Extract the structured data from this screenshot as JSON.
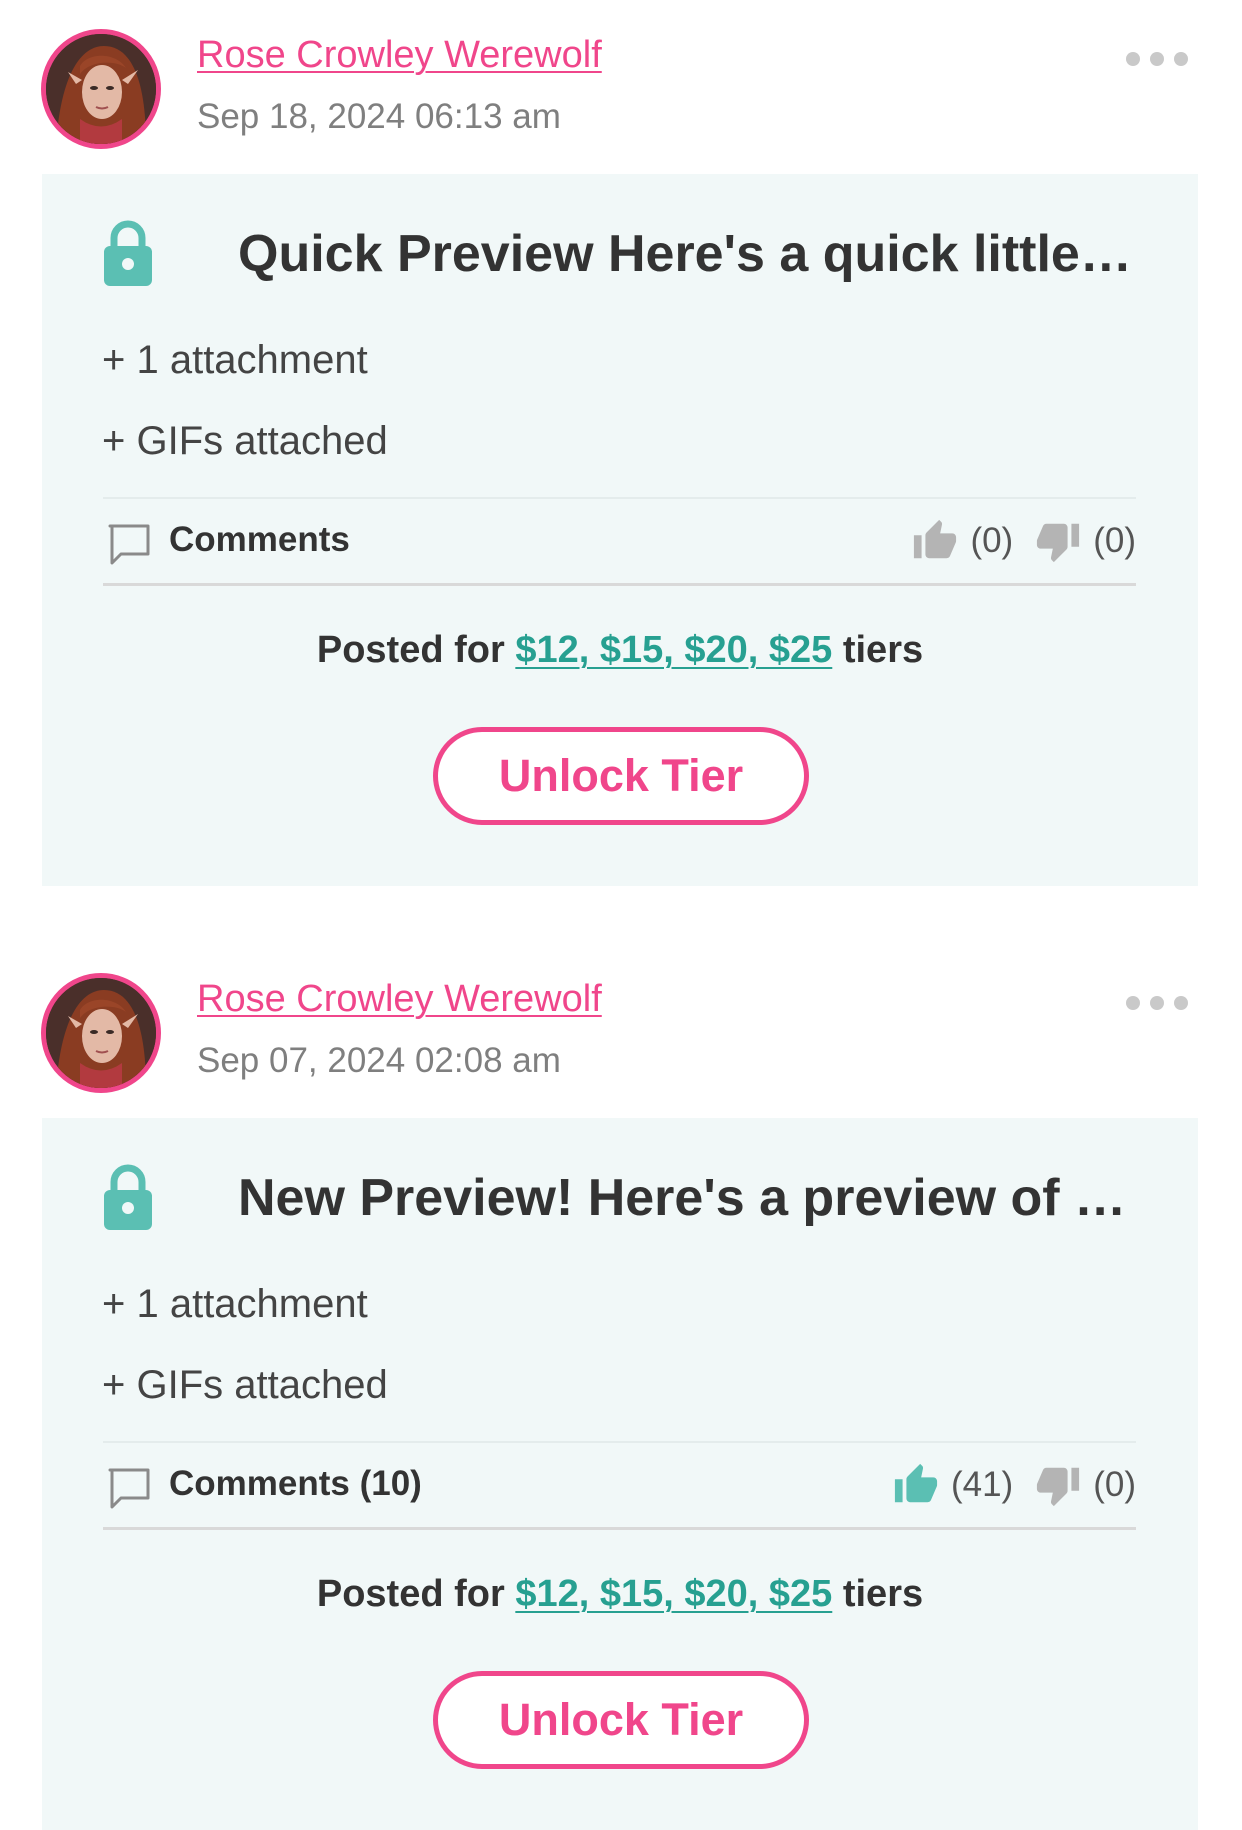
{
  "colors": {
    "accent_pink": "#f0468b",
    "accent_teal": "#5bbfb3",
    "link_teal": "#27a091",
    "card_bg": "#f1f8f8",
    "muted_gray": "#7f7f7f"
  },
  "posts": [
    {
      "author": "Rose Crowley Werewolf",
      "date": "Sep 18, 2024 06:13 am",
      "title": "Quick Preview Here's a quick little gli…",
      "attachments": "+ 1 attachment",
      "gifs": "+ GIFs attached",
      "comments_label": "Comments",
      "likes": "(0)",
      "dislikes": "(0)",
      "liked_state": "inactive",
      "posted_for_prefix": "Posted for",
      "tiers": "$12, $15, $20, $25",
      "posted_for_suffix": "tiers",
      "unlock_label": "Unlock Tier"
    },
    {
      "author": "Rose Crowley Werewolf",
      "date": "Sep 07, 2024 02:08 am",
      "title": "New Preview! Here's a preview of the…",
      "attachments": "+ 1 attachment",
      "gifs": "+ GIFs attached",
      "comments_label": "Comments (10)",
      "likes": "(41)",
      "dislikes": "(0)",
      "liked_state": "active",
      "posted_for_prefix": "Posted for",
      "tiers": "$12, $15, $20, $25",
      "posted_for_suffix": "tiers",
      "unlock_label": "Unlock Tier"
    }
  ],
  "icons": {
    "menu": "more-dots-icon",
    "lock": "lock-icon",
    "comment": "comment-icon",
    "like": "thumbs-up-icon",
    "dislike": "thumbs-down-icon"
  }
}
